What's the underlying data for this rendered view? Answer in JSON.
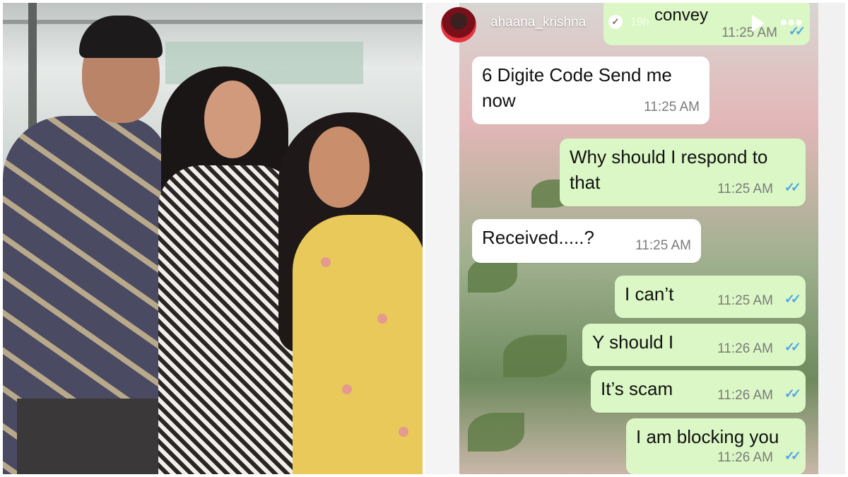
{
  "story": {
    "username": "ahaana_krishna",
    "post_time": "19h",
    "verified_icon": "verified-badge-icon",
    "play_icon": "play-icon",
    "more_icon": "more-options-icon",
    "more_label": "•••"
  },
  "messages": [
    {
      "direction": "out",
      "text": "convey",
      "time": "11:25 AM",
      "ticks": "✓✓"
    },
    {
      "direction": "in",
      "text_line1": "6 Digite Code Send me",
      "text_line2": "now",
      "time": "11:25 AM"
    },
    {
      "direction": "out",
      "text_line1": "Why should I respond to",
      "text_line2": "that",
      "time": "11:25 AM",
      "ticks": "✓✓"
    },
    {
      "direction": "in",
      "text": "Received.....?",
      "time": "11:25 AM"
    },
    {
      "direction": "out",
      "text": "I can’t",
      "time": "11:25 AM",
      "ticks": "✓✓"
    },
    {
      "direction": "out",
      "text": "Y should I",
      "time": "11:26 AM",
      "ticks": "✓✓"
    },
    {
      "direction": "out",
      "text": "It’s scam",
      "time": "11:26 AM",
      "ticks": "✓✓"
    },
    {
      "direction": "out",
      "text": "I am blocking you",
      "time": "11:26 AM",
      "ticks": "✓✓"
    }
  ],
  "colors": {
    "incoming_bubble": "#ffffff",
    "outgoing_bubble": "#dbf7c5",
    "read_ticks": "#4fa6e8"
  }
}
